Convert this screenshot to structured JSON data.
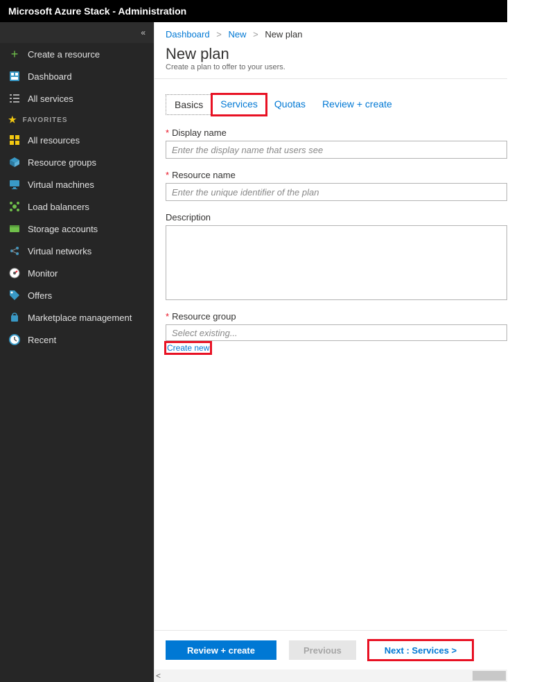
{
  "topbar": {
    "title": "Microsoft Azure Stack - Administration"
  },
  "sidebar": {
    "create": "Create a resource",
    "dashboard": "Dashboard",
    "all_services": "All services",
    "favorites_label": "FAVORITES",
    "items": {
      "all_resources": "All resources",
      "resource_groups": "Resource groups",
      "virtual_machines": "Virtual machines",
      "load_balancers": "Load balancers",
      "storage_accounts": "Storage accounts",
      "virtual_networks": "Virtual networks",
      "monitor": "Monitor",
      "offers": "Offers",
      "marketplace": "Marketplace management",
      "recent": "Recent"
    }
  },
  "breadcrumb": {
    "dashboard": "Dashboard",
    "new": "New",
    "current": "New plan"
  },
  "page": {
    "title": "New plan",
    "subtitle": "Create a plan to offer to your users."
  },
  "tabs": {
    "basics": "Basics",
    "services": "Services",
    "quotas": "Quotas",
    "review": "Review + create"
  },
  "form": {
    "display_name_label": "Display name",
    "display_name_placeholder": "Enter the display name that users see",
    "resource_name_label": "Resource name",
    "resource_name_placeholder": "Enter the unique identifier of the plan",
    "description_label": "Description",
    "resource_group_label": "Resource group",
    "resource_group_placeholder": "Select existing...",
    "create_new": "Create new"
  },
  "footer": {
    "review": "Review + create",
    "previous": "Previous",
    "next": "Next : Services >"
  }
}
